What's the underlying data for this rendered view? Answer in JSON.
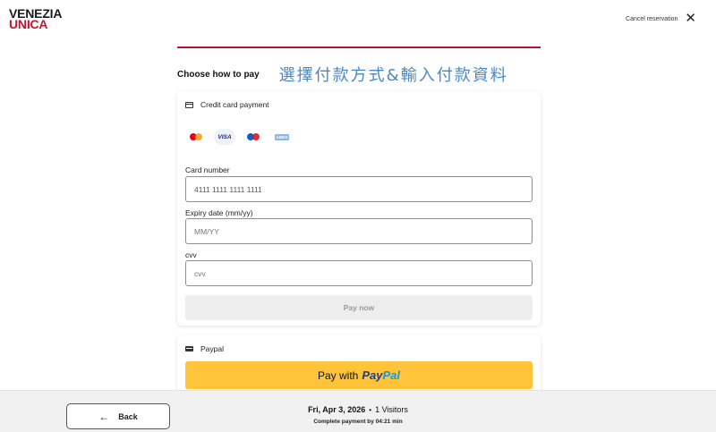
{
  "header": {
    "logo_line1": "VENEZIA",
    "logo_line2": "UNICA",
    "cancel_label": "Cancel reservation",
    "close_glyph": "✕"
  },
  "main": {
    "heading": "Choose how to pay",
    "annotation": "選擇付款方式&輸入付款資料"
  },
  "credit_card": {
    "title": "Credit card payment",
    "brands": [
      "mastercard",
      "VISA",
      "maestro",
      "AMEX"
    ],
    "card_number_label": "Card number",
    "card_number_value": "4111 1111 1111 1111",
    "expiry_label": "Expiry date (mm/yy)",
    "expiry_placeholder": "MM/YY",
    "cvv_label": "cvv",
    "cvv_placeholder": "cvv",
    "pay_now_label": "Pay now"
  },
  "paypal": {
    "title": "Paypal",
    "button_prefix": "Pay with",
    "brand_part1": "Pay",
    "brand_part2": "Pal"
  },
  "footer": {
    "back_label": "Back",
    "back_arrow": "←",
    "date": "Fri, Apr 3, 2026",
    "separator": "•",
    "visitors": "1 Visitors",
    "timer_text": "Complete payment by 04:21 min"
  },
  "colors": {
    "brand_red": "#c4122f",
    "paypal_yellow": "#ffc439",
    "annotation_blue": "#4a87c9"
  }
}
